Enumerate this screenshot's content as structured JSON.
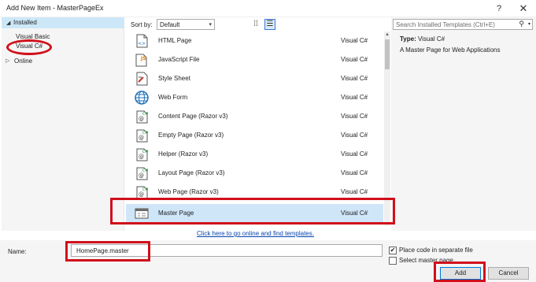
{
  "window": {
    "title": "Add New Item - MasterPageEx",
    "help_label": "?",
    "close_label": "✕"
  },
  "tree": {
    "installed": "Installed",
    "visual_basic": "Visual Basic",
    "visual_csharp": "Visual C#",
    "online": "Online"
  },
  "toolbar": {
    "sort_by_label": "Sort by:",
    "sort_value": "Default"
  },
  "templates": [
    {
      "name": "HTML Page",
      "lang": "Visual C#",
      "icon": "html-page-icon"
    },
    {
      "name": "JavaScript File",
      "lang": "Visual C#",
      "icon": "javascript-file-icon"
    },
    {
      "name": "Style Sheet",
      "lang": "Visual C#",
      "icon": "style-sheet-icon"
    },
    {
      "name": "Web Form",
      "lang": "Visual C#",
      "icon": "web-form-icon"
    },
    {
      "name": "Content Page (Razor v3)",
      "lang": "Visual C#",
      "icon": "razor-page-icon"
    },
    {
      "name": "Empty Page (Razor v3)",
      "lang": "Visual C#",
      "icon": "razor-page-icon"
    },
    {
      "name": "Helper (Razor v3)",
      "lang": "Visual C#",
      "icon": "razor-page-icon"
    },
    {
      "name": "Layout Page (Razor v3)",
      "lang": "Visual C#",
      "icon": "razor-page-icon"
    },
    {
      "name": "Web Page (Razor v3)",
      "lang": "Visual C#",
      "icon": "razor-page-icon"
    },
    {
      "name": "Master Page",
      "lang": "Visual C#",
      "icon": "master-page-icon"
    }
  ],
  "online_link": "Click here to go online and find templates.",
  "search": {
    "placeholder": "Search Installed Templates (Ctrl+E)"
  },
  "details": {
    "type_label": "Type:",
    "type_value": "Visual C#",
    "description": "A Master Page for Web Applications"
  },
  "bottom": {
    "name_label": "Name:",
    "name_value": "HomePage.master",
    "place_code_label": "Place code in separate file",
    "place_code_checked": true,
    "select_master_label": "Select master page",
    "select_master_checked": false,
    "add_label": "Add",
    "cancel_label": "Cancel"
  },
  "colors": {
    "highlight": "#d0101a",
    "selection": "#cfe5f8",
    "tree_selection": "#cce8f8",
    "link": "#0645ad"
  }
}
